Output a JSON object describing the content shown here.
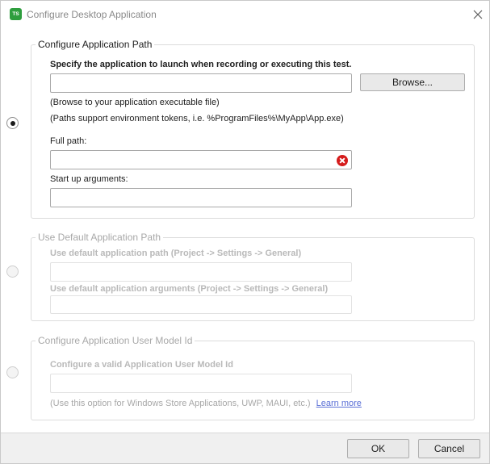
{
  "window": {
    "app_icon_text": "TS",
    "title": "Configure Desktop Application"
  },
  "app_path": {
    "legend": "Configure Application Path",
    "specify_label": "Specify the application to launch when recording or executing this test.",
    "path_value": "",
    "browse_label": "Browse...",
    "hint_browse": "(Browse to your application executable file)",
    "hint_tokens": "(Paths support environment tokens, i.e. %ProgramFiles%\\MyApp\\App.exe)",
    "full_path_label": "Full path:",
    "full_path_value": "",
    "startup_args_label": "Start up arguments:",
    "startup_args_value": ""
  },
  "default_path": {
    "legend": "Use Default Application Path",
    "path_label": "Use default application path (Project -> Settings -> General)",
    "path_value": "",
    "args_label": "Use default application arguments (Project -> Settings -> General)",
    "args_value": ""
  },
  "user_model": {
    "legend": "Configure Application User Model Id",
    "label": "Configure a valid Application User Model Id",
    "value": "",
    "note": "(Use this option for Windows Store Applications, UWP, MAUI, etc.)",
    "learn_more": "Learn more"
  },
  "footer": {
    "ok_label": "OK",
    "cancel_label": "Cancel"
  },
  "colors": {
    "app_icon": "#2e9e3e",
    "error": "#d51c1c",
    "link": "#5a6fd6"
  }
}
